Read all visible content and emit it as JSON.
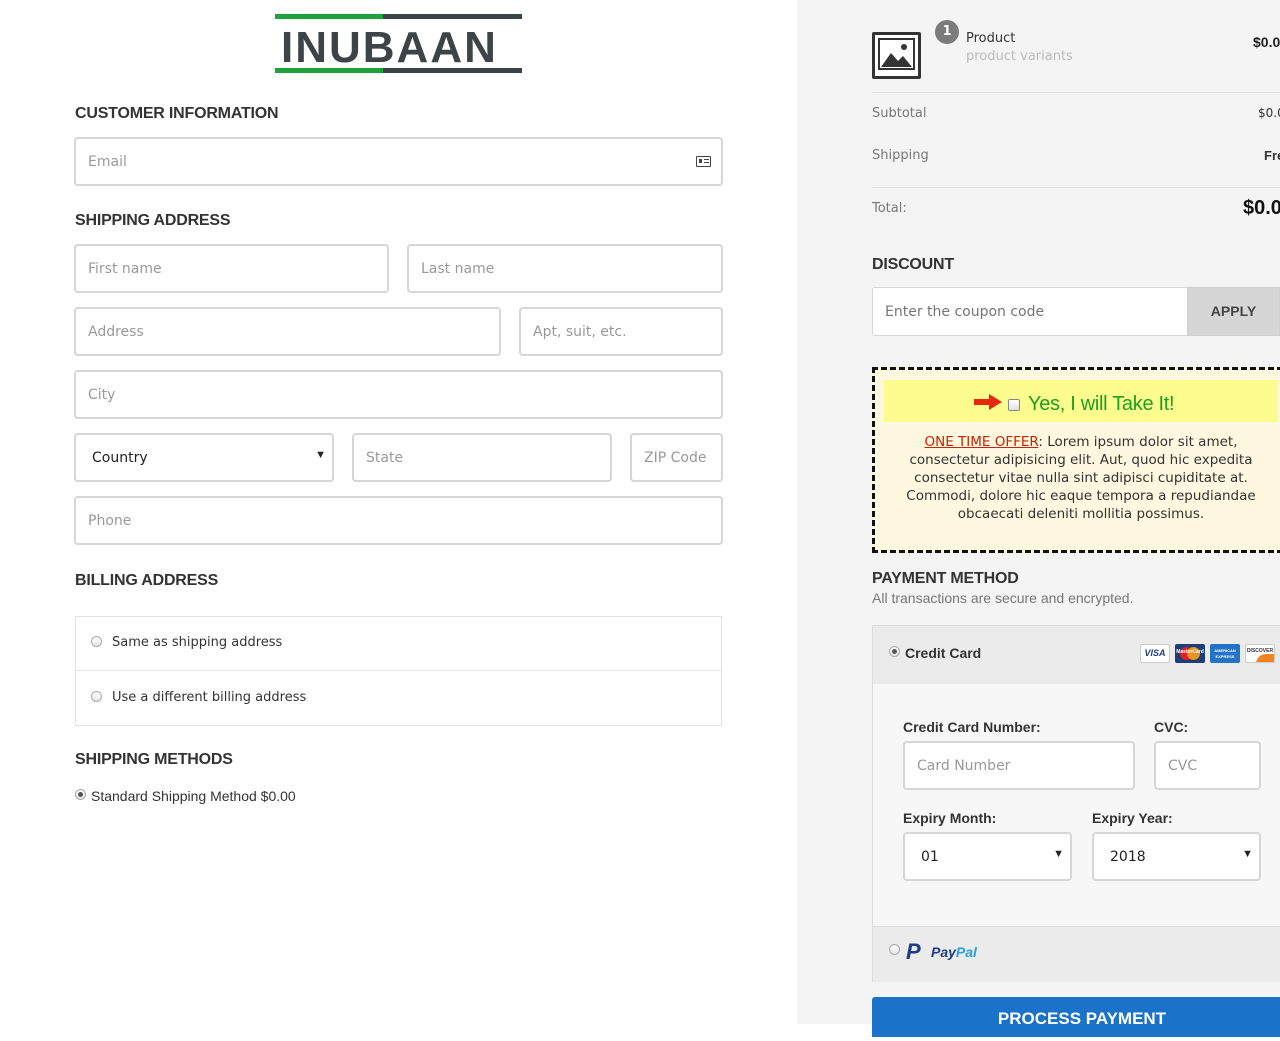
{
  "logo": {
    "text": "INUBAAN"
  },
  "customer": {
    "title": "CUSTOMER INFORMATION",
    "email_placeholder": "Email"
  },
  "shipping": {
    "title": "SHIPPING ADDRESS",
    "first_name": "First name",
    "last_name": "Last name",
    "address": "Address",
    "apt": "Apt, suit, etc.",
    "city": "City",
    "country": "Country",
    "state": "State",
    "zip": "ZIP Code",
    "phone": "Phone"
  },
  "billing": {
    "title": "BILLING ADDRESS",
    "option_same": "Same as shipping address",
    "option_different": "Use a different billing address"
  },
  "shipping_methods": {
    "title": "SHIPPING METHODS",
    "option": "Standard Shipping Method $0.00"
  },
  "summary": {
    "quantity": "1",
    "product_name": "Product",
    "product_variants": "product variants",
    "product_price": "$0.0",
    "subtotal_label": "Subtotal",
    "subtotal_value": "$0.0",
    "shipping_label": "Shipping",
    "shipping_value": "Fre",
    "total_label": "Total:",
    "total_value": "$0.0"
  },
  "discount": {
    "title": "DISCOUNT",
    "placeholder": "Enter the coupon code",
    "apply": "APPLY"
  },
  "offer": {
    "cta": "Yes, I will Take It!",
    "headline": "ONE TIME OFFER",
    "body": ": Lorem ipsum dolor sit amet, consectetur adipisicing elit. Aut, quod hic expedita consectetur vitae nulla sint adipisci cupiditate at. Commodi, dolore hic eaque tempora a repudiandae obcaecati deleniti mollitia possimus."
  },
  "payment": {
    "title": "PAYMENT METHOD",
    "subtitle": "All transactions are secure and encrypted.",
    "credit_card_label": "Credit Card",
    "card_number_label": "Credit Card Number:",
    "card_number_placeholder": "Card Number",
    "cvc_label": "CVC:",
    "cvc_placeholder": "CVC",
    "expiry_month_label": "Expiry Month:",
    "expiry_month_value": "01",
    "expiry_year_label": "Expiry Year:",
    "expiry_year_value": "2018",
    "paypal_pay": "Pay",
    "paypal_pal": "Pal",
    "process_button": "PROCESS PAYMENT",
    "card_brands": [
      "VISA",
      "MasterCard",
      "AMERICAN EXPRESS",
      "DISCOVER"
    ]
  },
  "colors": {
    "logo_green": "#1ea23c",
    "logo_dark": "#3d4447",
    "offer_green": "#1ea01e",
    "offer_red": "#cc2200",
    "offer_bg": "#fdf8df",
    "offer_highlight": "#fdfd8f",
    "process_blue": "#1a73c8"
  }
}
